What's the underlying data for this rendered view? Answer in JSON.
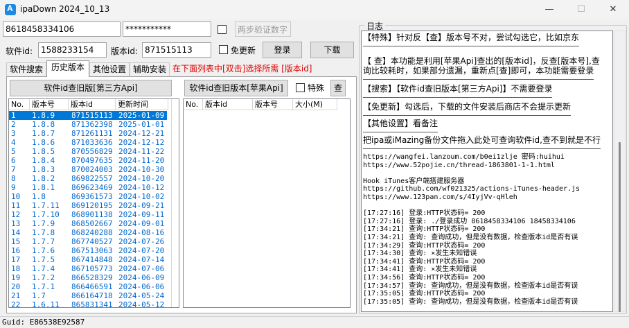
{
  "window": {
    "title": "ipaDown 2024_10_13",
    "minimize_glyph": "—",
    "maximize_glyph": "☐",
    "close_glyph": "✕"
  },
  "login": {
    "account_value": "8618458334106",
    "password_value": "***********",
    "two_step_placeholder": "两步验证数字"
  },
  "app_row": {
    "software_id_label": "软件id:",
    "software_id_value": "1588233154",
    "version_id_label": "版本id:",
    "version_id_value": "871515113",
    "no_update_label": "免更新",
    "login_button": "登录",
    "download_button": "下载"
  },
  "tabs": [
    {
      "label": "软件搜索",
      "active": false
    },
    {
      "label": "历史版本",
      "active": true
    },
    {
      "label": "其他设置",
      "active": false
    },
    {
      "label": "辅助安装",
      "active": false
    }
  ],
  "tab_hint": "在下面列表中[双击]选择所需 [版本id]",
  "history": {
    "third_party_button": "软件id查旧版[第三方Api]",
    "apple_button": "软件id查旧版本[苹果Api]",
    "special_label": "特殊",
    "query_button": "查",
    "left_columns": [
      "No.",
      "版本号",
      "版本id",
      "更新时间"
    ],
    "right_columns": [
      "No.",
      "版本id",
      "版本号",
      "大小(M)"
    ],
    "rows": [
      [
        "1",
        "1.8.9",
        "871515113",
        "2025-01-09"
      ],
      [
        "2",
        "1.8.8",
        "871362398",
        "2025-01-01"
      ],
      [
        "3",
        "1.8.7",
        "871261131",
        "2024-12-21"
      ],
      [
        "4",
        "1.8.6",
        "871033636",
        "2024-12-12"
      ],
      [
        "5",
        "1.8.5",
        "870556829",
        "2024-11-22"
      ],
      [
        "6",
        "1.8.4",
        "870497635",
        "2024-11-20"
      ],
      [
        "7",
        "1.8.3",
        "870024003",
        "2024-10-30"
      ],
      [
        "8",
        "1.8.2",
        "869822557",
        "2024-10-20"
      ],
      [
        "9",
        "1.8.1",
        "869623469",
        "2024-10-12"
      ],
      [
        "10",
        "1.8",
        "869361573",
        "2024-10-02"
      ],
      [
        "11",
        "1.7.11",
        "869120195",
        "2024-09-21"
      ],
      [
        "12",
        "1.7.10",
        "868901138",
        "2024-09-11"
      ],
      [
        "13",
        "1.7.9",
        "868502667",
        "2024-09-01"
      ],
      [
        "14",
        "1.7.8",
        "868240288",
        "2024-08-16"
      ],
      [
        "15",
        "1.7.7",
        "867740527",
        "2024-07-26"
      ],
      [
        "16",
        "1.7.6",
        "867513063",
        "2024-07-20"
      ],
      [
        "17",
        "1.7.5",
        "867414848",
        "2024-07-14"
      ],
      [
        "18",
        "1.7.4",
        "867105773",
        "2024-07-06"
      ],
      [
        "19",
        "1.7.2",
        "866528329",
        "2024-06-09"
      ],
      [
        "20",
        "1.7.1",
        "866466591",
        "2024-06-06"
      ],
      [
        "21",
        "1.7",
        "866164718",
        "2024-05-24"
      ],
      [
        "22",
        "1.6.11",
        "865831341",
        "2024-05-12"
      ]
    ]
  },
  "log": {
    "title": "日志",
    "tips": [
      "【特殊】针对反【查】版本号不对，尝试勾选它，比如京东",
      "【 查】本功能是利用[苹果Api]查出的[版本id]，反查[版本号],查",
      "询比较耗时，如果部分遗漏，重新点[查]即可，本功能需要登录",
      "【搜索】【软件id查旧版本[第三方Api]】不需要登录",
      "【免更新】勾选后，下载的文件安装后商店不会提示更新",
      "【其他设置】看备注",
      "把ipa或iMazing备份文件拖入此处可查询软件id,查不到就是不行"
    ],
    "links": [
      "https://wangfei.lanzoum.com/b0ei1zlje 密码:huihui",
      "https://www.52pojie.cn/thread-1863801-1-1.html",
      "",
      "Hook iTunes客户端搭建服务器",
      "https://github.com/wf021325/actions-iTunes-header.js",
      "https://www.123pan.com/s/4IyjVv-qHleh",
      "",
      "[17:27:16] 登录:HTTP状态码= 200",
      "[17:27:16] 登录: ./登录成功 8618458334106 18458334106",
      "[17:34:21] 查询:HTTP状态码= 200",
      "[17:34:21] 查询: 查询成功，但是没有数据，检查版本id是否有误",
      "[17:34:29] 查询:HTTP状态码= 200",
      "[17:34:30] 查询: ×发生未知错误",
      "[17:34:41] 查询:HTTP状态码= 200",
      "[17:34:41] 查询: ×发生未知错误",
      "[17:34:56] 查询:HTTP状态码= 200",
      "[17:34:57] 查询: 查询成功，但是没有数据，检查版本id是否有误",
      "[17:35:05] 查询:HTTP状态码= 200",
      "[17:35:05] 查询: 查询成功，但是没有数据，检查版本id是否有误"
    ]
  },
  "status": {
    "text": "Guid: E86538E92587"
  }
}
